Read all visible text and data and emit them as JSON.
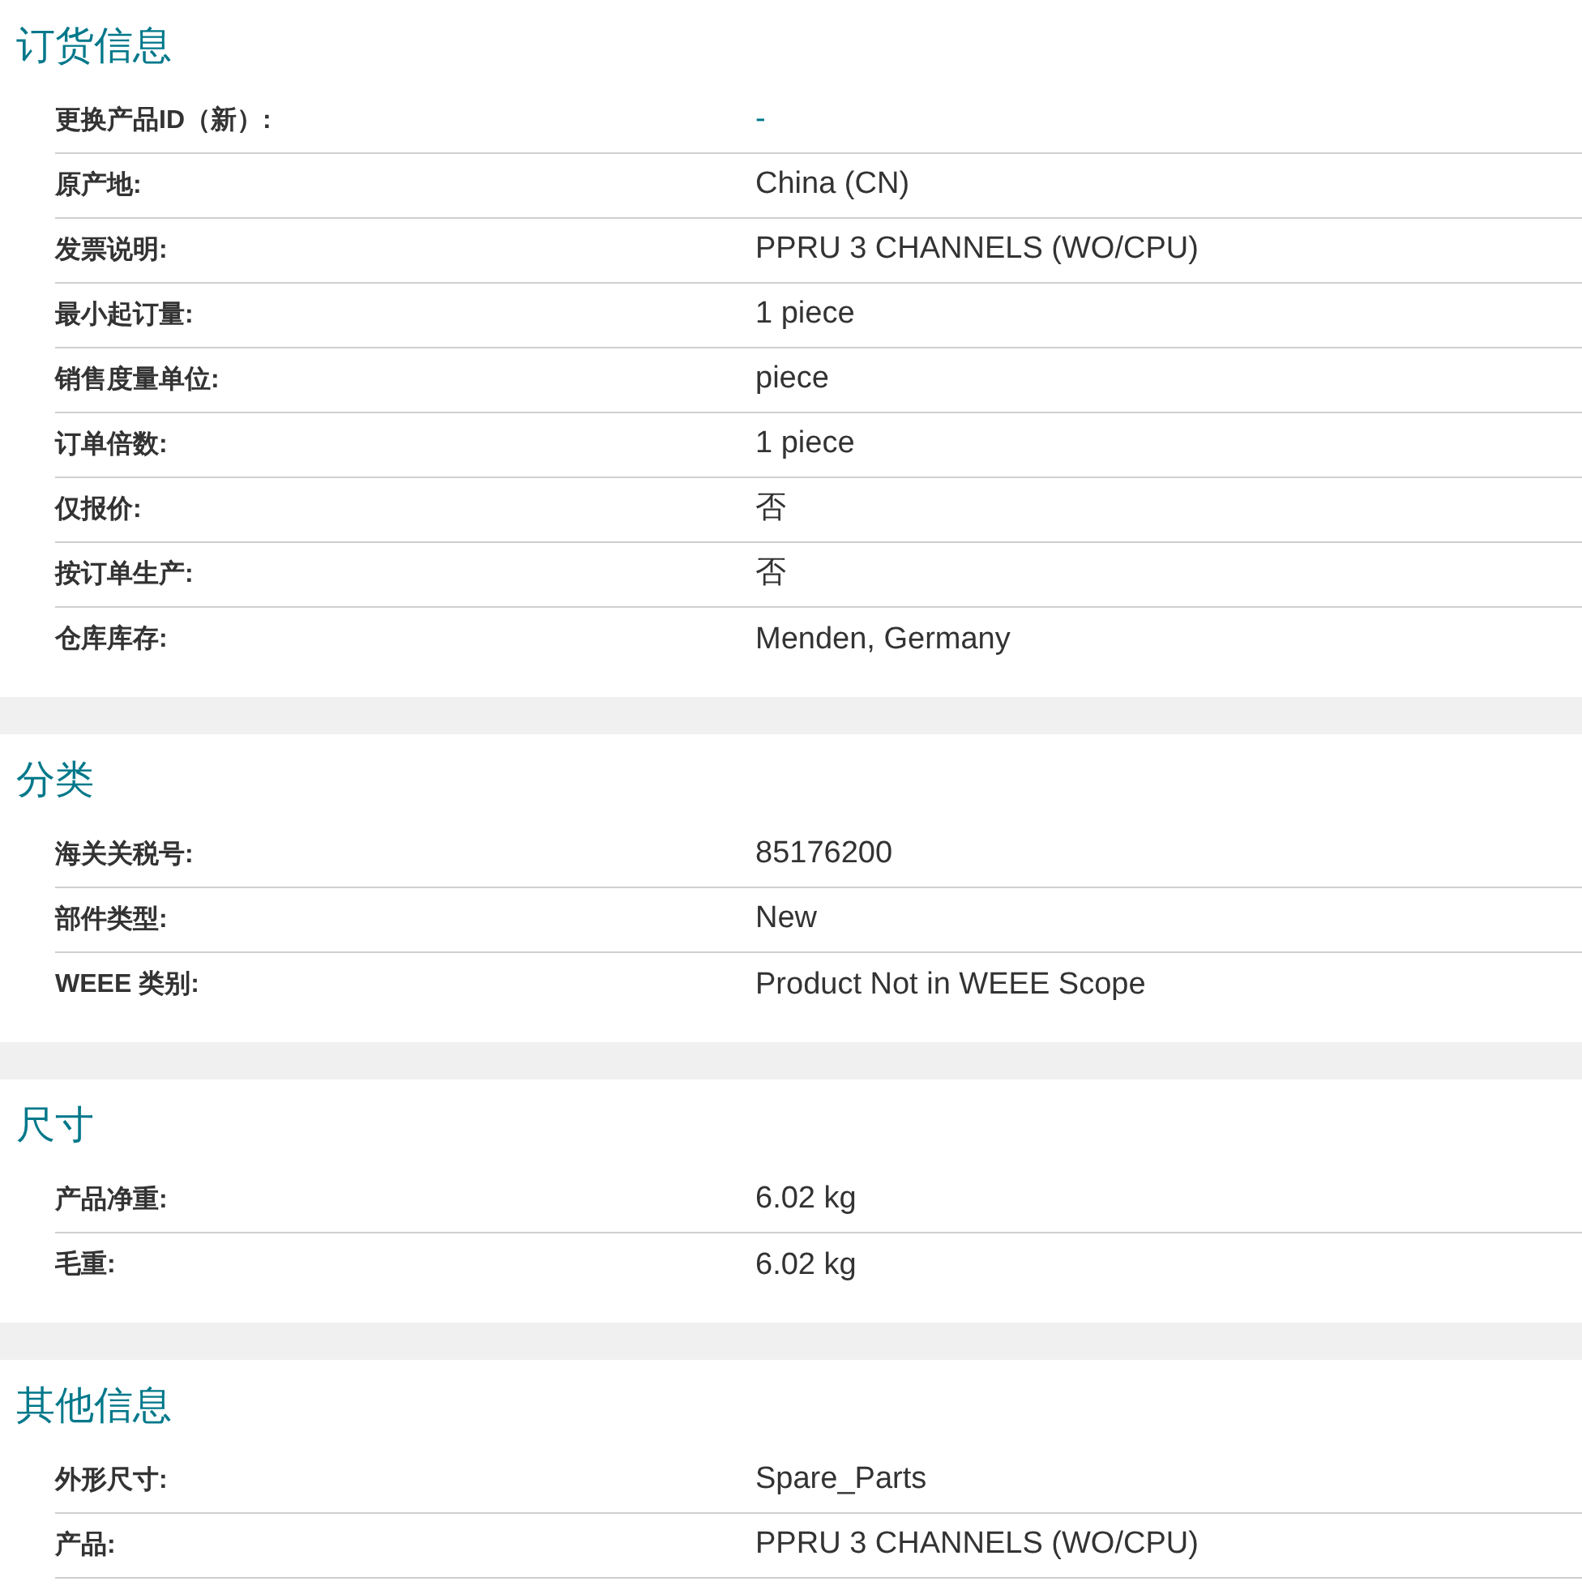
{
  "sections": [
    {
      "title": "订货信息",
      "rows": [
        {
          "label": "更换产品ID（新）:",
          "value": "-",
          "link": true
        },
        {
          "label": "原产地:",
          "value": "China (CN)",
          "link": false
        },
        {
          "label": "发票说明:",
          "value": "PPRU 3 CHANNELS (WO/CPU)",
          "link": false
        },
        {
          "label": "最小起订量:",
          "value": "1 piece",
          "link": false
        },
        {
          "label": "销售度量单位:",
          "value": "piece",
          "link": false
        },
        {
          "label": "订单倍数:",
          "value": "1 piece",
          "link": false
        },
        {
          "label": "仅报价:",
          "value": "否",
          "link": false
        },
        {
          "label": "按订单生产:",
          "value": "否",
          "link": false
        },
        {
          "label": "仓库库存:",
          "value": "Menden, Germany",
          "link": false
        }
      ]
    },
    {
      "title": "分类",
      "rows": [
        {
          "label": "海关关税号:",
          "value": "85176200",
          "link": false
        },
        {
          "label": "部件类型:",
          "value": "New",
          "link": false
        },
        {
          "label": "WEEE 类别:",
          "value": "Product Not in WEEE Scope",
          "link": false
        }
      ]
    },
    {
      "title": "尺寸",
      "rows": [
        {
          "label": "产品净重:",
          "value": "6.02 kg",
          "link": false
        },
        {
          "label": "毛重:",
          "value": "6.02 kg",
          "link": false
        }
      ]
    },
    {
      "title": "其他信息",
      "rows": [
        {
          "label": "外形尺寸:",
          "value": "Spare_Parts",
          "link": false
        },
        {
          "label": "产品:",
          "value": "PPRU 3 CHANNELS (WO/CPU)",
          "link": false
        }
      ]
    }
  ]
}
